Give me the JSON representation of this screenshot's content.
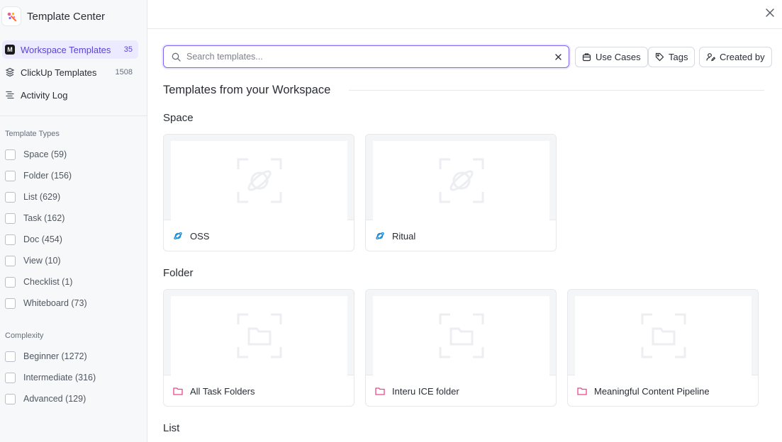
{
  "app": {
    "title": "Template Center"
  },
  "sidebar": {
    "nav": [
      {
        "label": "Workspace Templates",
        "count": "35",
        "icon": "workspace-m-badge",
        "badge_letter": "M",
        "active": true
      },
      {
        "label": "ClickUp Templates",
        "count": "1508",
        "icon": "layers-icon"
      },
      {
        "label": "Activity Log",
        "count": "",
        "icon": "activity-log-icon"
      }
    ],
    "template_types": {
      "heading": "Template Types",
      "items": [
        "Space (59)",
        "Folder (156)",
        "List (629)",
        "Task (162)",
        "Doc (454)",
        "View (10)",
        "Checklist (1)",
        "Whiteboard (73)"
      ]
    },
    "complexity": {
      "heading": "Complexity",
      "items": [
        "Beginner (1272)",
        "Intermediate (316)",
        "Advanced (129)"
      ]
    }
  },
  "search": {
    "placeholder": "Search templates...",
    "value": ""
  },
  "filters": {
    "use_cases": "Use Cases",
    "tags": "Tags",
    "created_by": "Created by"
  },
  "main": {
    "section_title": "Templates from your Workspace",
    "groups": [
      {
        "title": "Space",
        "cards": [
          {
            "name": "OSS",
            "icon": "space-planet-icon"
          },
          {
            "name": "Ritual",
            "icon": "space-planet-icon"
          }
        ]
      },
      {
        "title": "Folder",
        "cards": [
          {
            "name": "All Task Folders",
            "icon": "folder-icon"
          },
          {
            "name": "Interu ICE folder",
            "icon": "folder-icon"
          },
          {
            "name": "Meaningful Content Pipeline",
            "icon": "folder-icon"
          }
        ]
      },
      {
        "title": "List",
        "cards": []
      }
    ]
  },
  "colors": {
    "accent": "#7b68ee",
    "active_bg": "#eceaff",
    "space_icon": "#1a8bd6",
    "folder_icon": "#e8498b"
  }
}
